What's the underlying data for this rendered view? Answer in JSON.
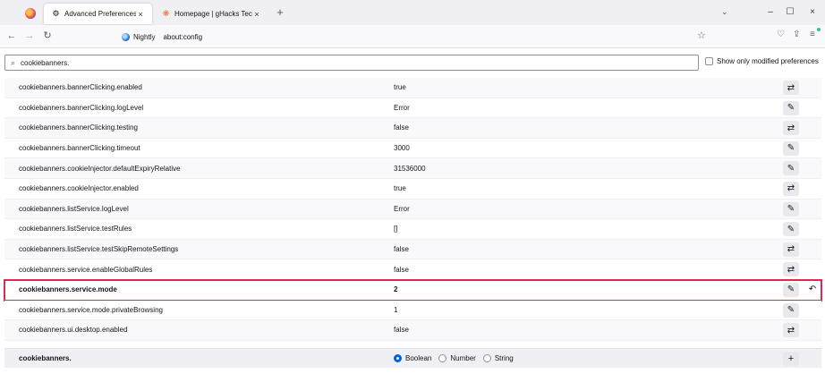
{
  "tabs": {
    "active": {
      "title": "Advanced Preferences",
      "icon": "gear-icon",
      "close": "×"
    },
    "inactive": {
      "title": "Homepage | gHacks Technolog",
      "icon": "ghacks-icon",
      "close": "×"
    },
    "new_tab": "+",
    "list_all": "⌄"
  },
  "window": {
    "minimize": "–",
    "maximize": "☐",
    "close": "×"
  },
  "nav": {
    "back": "←",
    "forward": "→",
    "reload": "↻",
    "identity_label": "Nightly",
    "url": "about:config",
    "bookmark": "☆",
    "pocket": "♡",
    "share": "⇪",
    "menu": "≡"
  },
  "search": {
    "icon": "⌕",
    "value": "cookiebanners."
  },
  "modified_toggle": {
    "label": "Show only modified preferences",
    "checked": false
  },
  "prefs": [
    {
      "name": "cookiebanners.bannerClicking.enabled",
      "value": "true",
      "action": "toggle"
    },
    {
      "name": "cookiebanners.bannerClicking.logLevel",
      "value": "Error",
      "action": "edit"
    },
    {
      "name": "cookiebanners.bannerClicking.testing",
      "value": "false",
      "action": "toggle"
    },
    {
      "name": "cookiebanners.bannerClicking.timeout",
      "value": "3000",
      "action": "edit"
    },
    {
      "name": "cookiebanners.cookieInjector.defaultExpiryRelative",
      "value": "31536000",
      "action": "edit"
    },
    {
      "name": "cookiebanners.cookieInjector.enabled",
      "value": "true",
      "action": "toggle"
    },
    {
      "name": "cookiebanners.listService.logLevel",
      "value": "Error",
      "action": "edit"
    },
    {
      "name": "cookiebanners.listService.testRules",
      "value": "[]",
      "action": "edit"
    },
    {
      "name": "cookiebanners.listService.testSkipRemoteSettings",
      "value": "false",
      "action": "toggle"
    },
    {
      "name": "cookiebanners.service.enableGlobalRules",
      "value": "false",
      "action": "toggle"
    },
    {
      "name": "cookiebanners.service.mode",
      "value": "2",
      "action": "edit",
      "modified": true
    },
    {
      "name": "cookiebanners.service.mode.privateBrowsing",
      "value": "1",
      "action": "edit"
    },
    {
      "name": "cookiebanners.ui.desktop.enabled",
      "value": "false",
      "action": "toggle"
    }
  ],
  "action_glyphs": {
    "toggle": "⇄",
    "edit": "✎",
    "reset": "↶",
    "add": "+"
  },
  "add_row": {
    "name": "cookiebanners.",
    "types": [
      {
        "label": "Boolean",
        "checked": true
      },
      {
        "label": "Number",
        "checked": false
      },
      {
        "label": "String",
        "checked": false
      }
    ]
  },
  "colors": {
    "highlight": "#e22850",
    "accent": "#0061e0"
  }
}
